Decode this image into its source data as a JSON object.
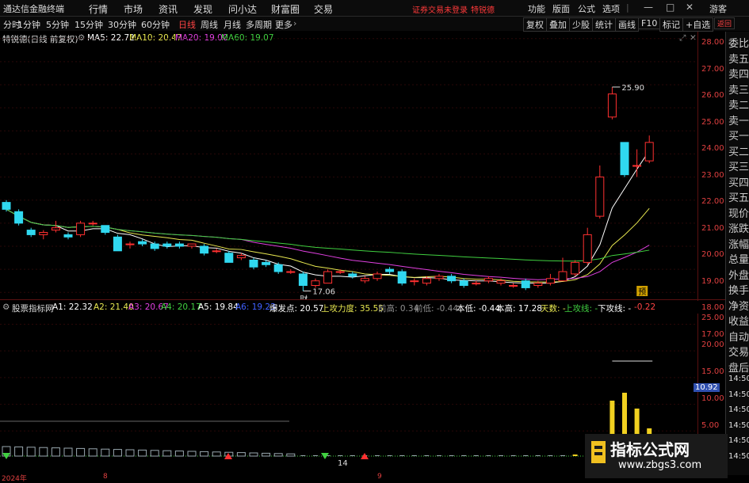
{
  "menubar": {
    "app_title": "通达信金融终端",
    "menus": [
      "行情",
      "市场",
      "资讯",
      "发现",
      "问小达",
      "财富圈",
      "交易"
    ],
    "warning": "证券交易未登录",
    "stock_name_red": "特锐德",
    "right_menus": [
      "功能",
      "版面",
      "公式",
      "选项",
      "|",
      "游客"
    ],
    "win_buttons": [
      "—",
      "□",
      "✕"
    ]
  },
  "toolbar": {
    "periods": [
      "分时",
      "1分钟",
      "5分钟",
      "15分钟",
      "30分钟",
      "60分钟",
      "日线",
      "周线",
      "月线",
      "多周期",
      "更多"
    ],
    "active_period": "日线",
    "right_buttons": [
      "复权",
      "叠加",
      "少股",
      "统计",
      "画线",
      "F10",
      "标记",
      "+自选",
      "返回"
    ]
  },
  "ma_line": {
    "title": "特锐德(日线 前复权)",
    "items": [
      {
        "label": "MA5: 22.72",
        "color": "#ffffff"
      },
      {
        "label": "MA10: 20.47",
        "color": "#e8e850"
      },
      {
        "label": "MA20: 19.00",
        "color": "#e040e0"
      },
      {
        "label": "MA60: 19.07",
        "color": "#40d040"
      }
    ]
  },
  "price_axis": {
    "ticks": [
      "28.00",
      "27.00",
      "26.00",
      "25.00",
      "24.00",
      "23.00",
      "22.00",
      "21.00",
      "20.00",
      "19.00",
      "18.00",
      "17.00"
    ]
  },
  "annotations": {
    "high": "25.90",
    "low": "17.06",
    "low_mark": "财",
    "right_mark": "预"
  },
  "sidebar": {
    "items": [
      "委比",
      "卖五",
      "卖四",
      "卖三",
      "卖二",
      "卖一",
      "买一",
      "买二",
      "买三",
      "买四",
      "买五",
      "现价",
      "涨跌",
      "涨幅",
      "总量",
      "外盘",
      "换手",
      "净资",
      "收益",
      "自动",
      "交易",
      "盘后",
      "14:50",
      "14:50",
      "14:50",
      "14:50",
      "14:50",
      "14:50"
    ]
  },
  "indicator": {
    "name": "股票指标网",
    "items": [
      {
        "label": "A1: 22.32",
        "color": "#ffffff"
      },
      {
        "label": "A2: 21.40",
        "color": "#e8e850"
      },
      {
        "label": "A3: 20.67",
        "color": "#e040e0"
      },
      {
        "label": "A4: 20.17",
        "color": "#40d040"
      },
      {
        "label": "A5: 19.84",
        "color": "#ffffff"
      },
      {
        "label": "A6: 19.23",
        "color": "#4060ff"
      },
      {
        "label": "爆发点: 20.57",
        "color": "#ffffff"
      },
      {
        "label": "上攻力度: 35.55",
        "color": "#e8e850"
      },
      {
        "label": "前高: 0.34",
        "color": "#909090"
      },
      {
        "label": "前低: -0.44",
        "color": "#909090"
      },
      {
        "label": "本低: -0.44",
        "color": "#ffffff"
      },
      {
        "label": "本高: 17.28",
        "color": "#ffffff"
      },
      {
        "label": "天数: -",
        "color": "#e8e850"
      },
      {
        "label": "上攻线: -",
        "color": "#40d040"
      },
      {
        "label": "下攻线: -",
        "color": "#ffffff"
      },
      {
        "label": "-0.22",
        "color": "#ff4444"
      }
    ],
    "axis_ticks": [
      "25.00",
      "20.00",
      "15.00",
      "10.00",
      "5.00"
    ],
    "current_value": "10.92",
    "marker_14": "14"
  },
  "date_axis": {
    "labels": [
      "2024年",
      "8",
      "9"
    ]
  },
  "watermark": {
    "title": "指标公式网",
    "url": "www.zbgs3.com"
  },
  "chart_data": {
    "type": "candlestick",
    "candles": [
      {
        "o": 20.9,
        "c": 20.6,
        "h": 21.0,
        "l": 20.5
      },
      {
        "o": 20.5,
        "c": 20.0,
        "h": 20.6,
        "l": 19.9
      },
      {
        "o": 19.7,
        "c": 19.5,
        "h": 19.8,
        "l": 19.4
      },
      {
        "o": 19.5,
        "c": 19.6,
        "h": 19.7,
        "l": 19.3
      },
      {
        "o": 19.7,
        "c": 19.8,
        "h": 20.1,
        "l": 19.6
      },
      {
        "o": 19.5,
        "c": 19.4,
        "h": 19.6,
        "l": 19.3
      },
      {
        "o": 19.5,
        "c": 20.0,
        "h": 20.1,
        "l": 19.4
      },
      {
        "o": 20.0,
        "c": 20.0,
        "h": 20.1,
        "l": 19.9
      },
      {
        "o": 19.9,
        "c": 19.6,
        "h": 19.9,
        "l": 19.5
      },
      {
        "o": 19.4,
        "c": 18.8,
        "h": 19.5,
        "l": 18.8
      },
      {
        "o": 19.1,
        "c": 19.1,
        "h": 19.2,
        "l": 18.9
      },
      {
        "o": 19.2,
        "c": 19.1,
        "h": 19.3,
        "l": 19.0
      },
      {
        "o": 19.1,
        "c": 18.9,
        "h": 19.2,
        "l": 18.8
      },
      {
        "o": 19.1,
        "c": 19.0,
        "h": 19.2,
        "l": 18.9
      },
      {
        "o": 19.1,
        "c": 19.0,
        "h": 19.2,
        "l": 18.9
      },
      {
        "o": 19.0,
        "c": 19.1,
        "h": 19.1,
        "l": 18.9
      },
      {
        "o": 19.0,
        "c": 18.7,
        "h": 19.1,
        "l": 18.6
      },
      {
        "o": 18.8,
        "c": 18.8,
        "h": 18.9,
        "l": 18.7
      },
      {
        "o": 18.7,
        "c": 18.3,
        "h": 18.8,
        "l": 18.3
      },
      {
        "o": 18.5,
        "c": 18.6,
        "h": 18.7,
        "l": 18.4
      },
      {
        "o": 18.4,
        "c": 18.1,
        "h": 18.5,
        "l": 18.0
      },
      {
        "o": 18.3,
        "c": 18.2,
        "h": 18.4,
        "l": 18.1
      },
      {
        "o": 18.2,
        "c": 17.9,
        "h": 18.3,
        "l": 17.8
      },
      {
        "o": 17.9,
        "c": 17.9,
        "h": 18.0,
        "l": 17.8
      },
      {
        "o": 17.8,
        "c": 17.3,
        "h": 17.9,
        "l": 17.06
      },
      {
        "o": 17.3,
        "c": 17.5,
        "h": 17.6,
        "l": 17.2
      },
      {
        "o": 17.4,
        "c": 17.9,
        "h": 18.0,
        "l": 17.4
      },
      {
        "o": 17.9,
        "c": 17.9,
        "h": 18.0,
        "l": 17.8
      },
      {
        "o": 17.8,
        "c": 17.7,
        "h": 17.9,
        "l": 17.6
      },
      {
        "o": 17.5,
        "c": 17.6,
        "h": 17.7,
        "l": 17.4
      },
      {
        "o": 17.6,
        "c": 17.8,
        "h": 17.9,
        "l": 17.5
      },
      {
        "o": 18.0,
        "c": 17.9,
        "h": 18.1,
        "l": 17.8
      },
      {
        "o": 17.9,
        "c": 17.4,
        "h": 18.0,
        "l": 17.3
      },
      {
        "o": 17.5,
        "c": 17.5,
        "h": 17.6,
        "l": 17.3
      },
      {
        "o": 17.4,
        "c": 17.6,
        "h": 17.7,
        "l": 17.3
      },
      {
        "o": 17.6,
        "c": 17.7,
        "h": 17.8,
        "l": 17.5
      },
      {
        "o": 17.7,
        "c": 17.5,
        "h": 17.8,
        "l": 17.4
      },
      {
        "o": 17.5,
        "c": 17.3,
        "h": 17.6,
        "l": 17.2
      },
      {
        "o": 17.4,
        "c": 17.4,
        "h": 17.5,
        "l": 17.3
      },
      {
        "o": 17.5,
        "c": 17.6,
        "h": 17.7,
        "l": 17.4
      },
      {
        "o": 17.4,
        "c": 17.5,
        "h": 17.6,
        "l": 17.3
      },
      {
        "o": 17.3,
        "c": 17.3,
        "h": 17.4,
        "l": 17.2
      },
      {
        "o": 17.5,
        "c": 17.2,
        "h": 17.6,
        "l": 17.1
      },
      {
        "o": 17.3,
        "c": 17.4,
        "h": 17.5,
        "l": 17.2
      },
      {
        "o": 17.4,
        "c": 17.6,
        "h": 17.8,
        "l": 17.3
      },
      {
        "o": 17.5,
        "c": 17.9,
        "h": 18.5,
        "l": 17.5
      },
      {
        "o": 17.8,
        "c": 18.3,
        "h": 18.4,
        "l": 17.7
      },
      {
        "o": 18.3,
        "c": 19.5,
        "h": 19.8,
        "l": 18.2
      },
      {
        "o": 20.3,
        "c": 22.0,
        "h": 22.5,
        "l": 20.2
      },
      {
        "o": 24.6,
        "c": 25.6,
        "h": 25.9,
        "l": 24.5
      },
      {
        "o": 23.5,
        "c": 22.1,
        "h": 23.5,
        "l": 22.0
      },
      {
        "o": 22.5,
        "c": 22.5,
        "h": 23.2,
        "l": 22.0
      },
      {
        "o": 22.7,
        "c": 23.5,
        "h": 23.8,
        "l": 22.6
      }
    ],
    "ylim": [
      16.7,
      28.3
    ]
  }
}
